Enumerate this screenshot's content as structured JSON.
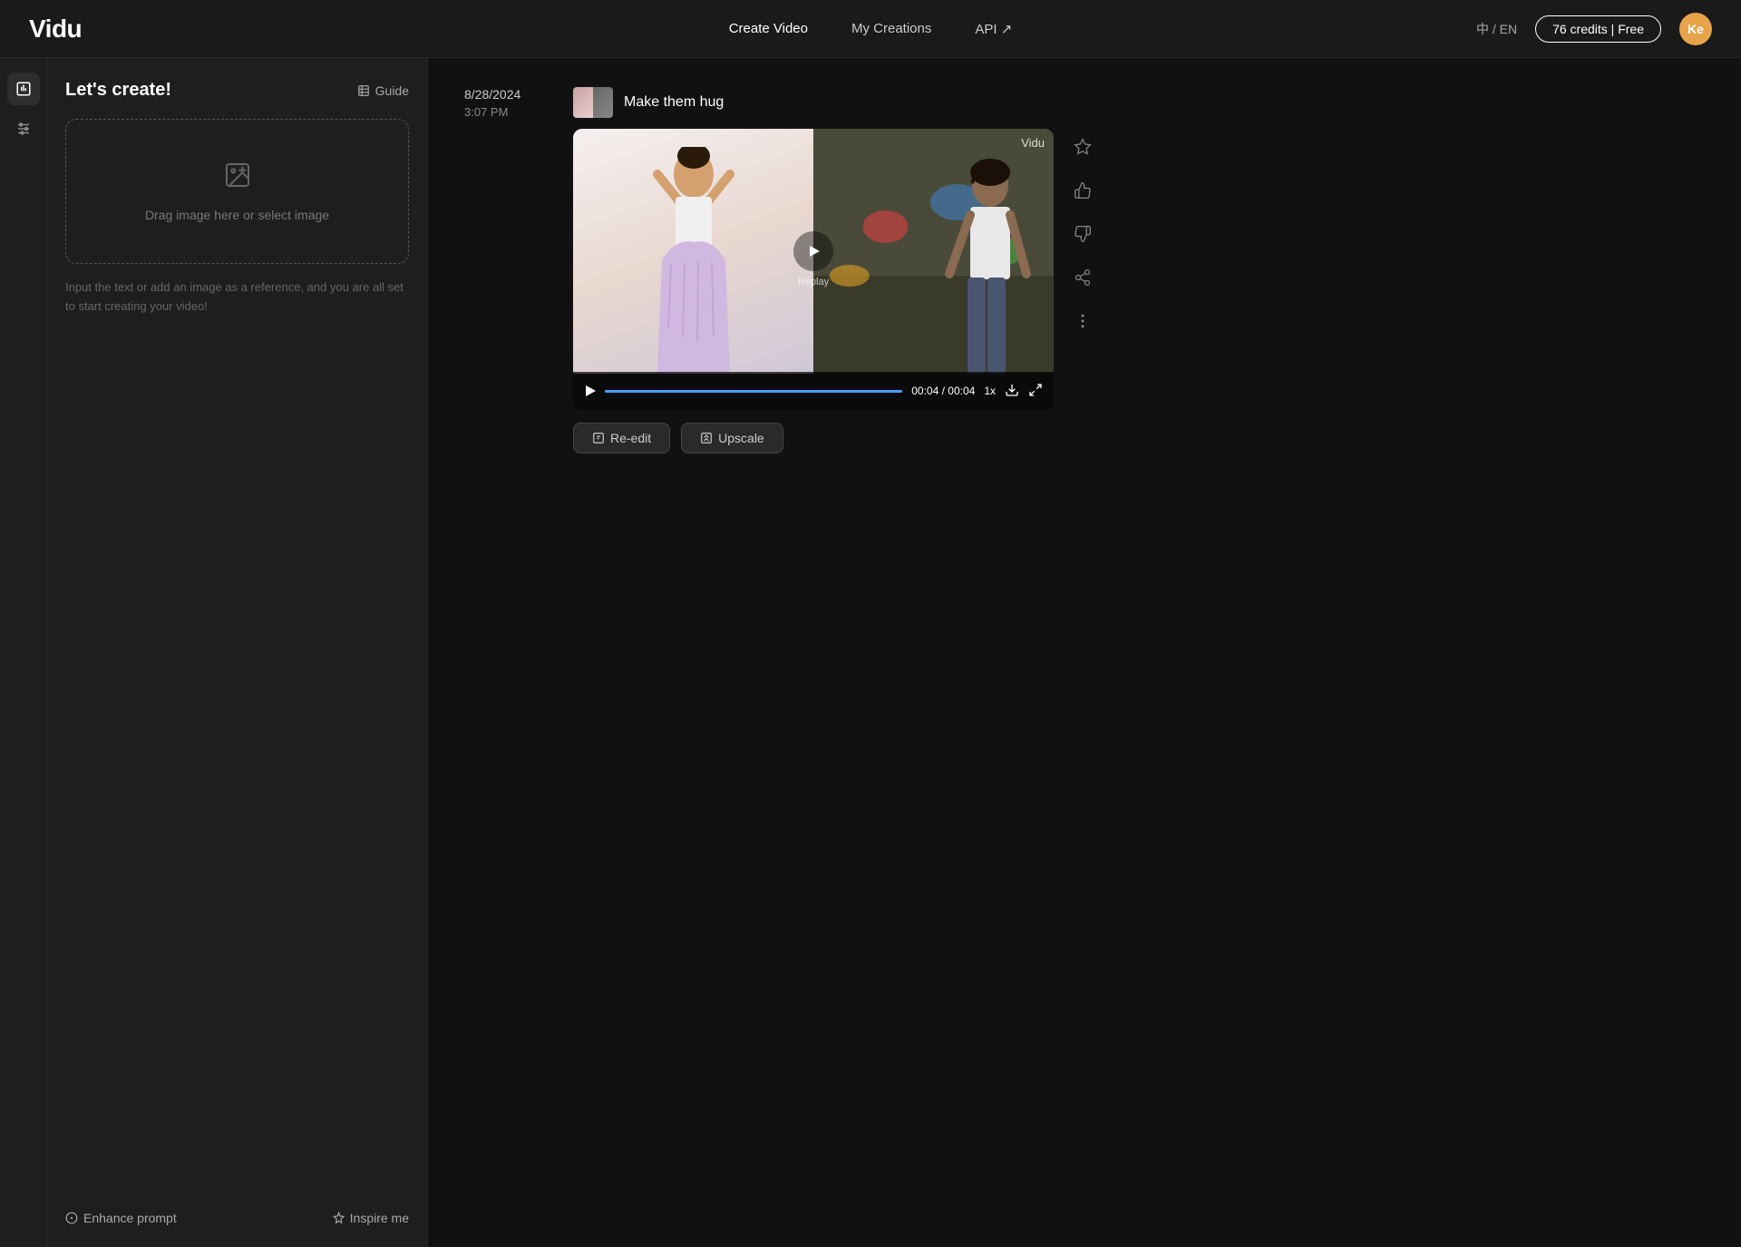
{
  "header": {
    "logo": "Vidu",
    "nav": {
      "create_video": "Create Video",
      "my_creations": "My Creations",
      "api": "API ↗"
    },
    "lang": "中 / EN",
    "credits": "76 credits | Free",
    "avatar_initials": "Ke"
  },
  "left_panel": {
    "title": "Let's create!",
    "guide_label": "Guide",
    "drop_zone_text": "Drag image here or select image",
    "hint_text": "Input the text or add an image as a reference, and you are all set to start creating your video!",
    "enhance_prompt": "Enhance prompt",
    "inspire_me": "Inspire me"
  },
  "video_card": {
    "date": "8/28/2024",
    "time": "3:07 PM",
    "title": "Make them hug",
    "watermark": "Vidu",
    "time_current": "00:04",
    "time_total": "00:04",
    "speed": "1x",
    "re_edit": "Re-edit",
    "upscale": "Upscale",
    "replay_label": "Replay"
  }
}
